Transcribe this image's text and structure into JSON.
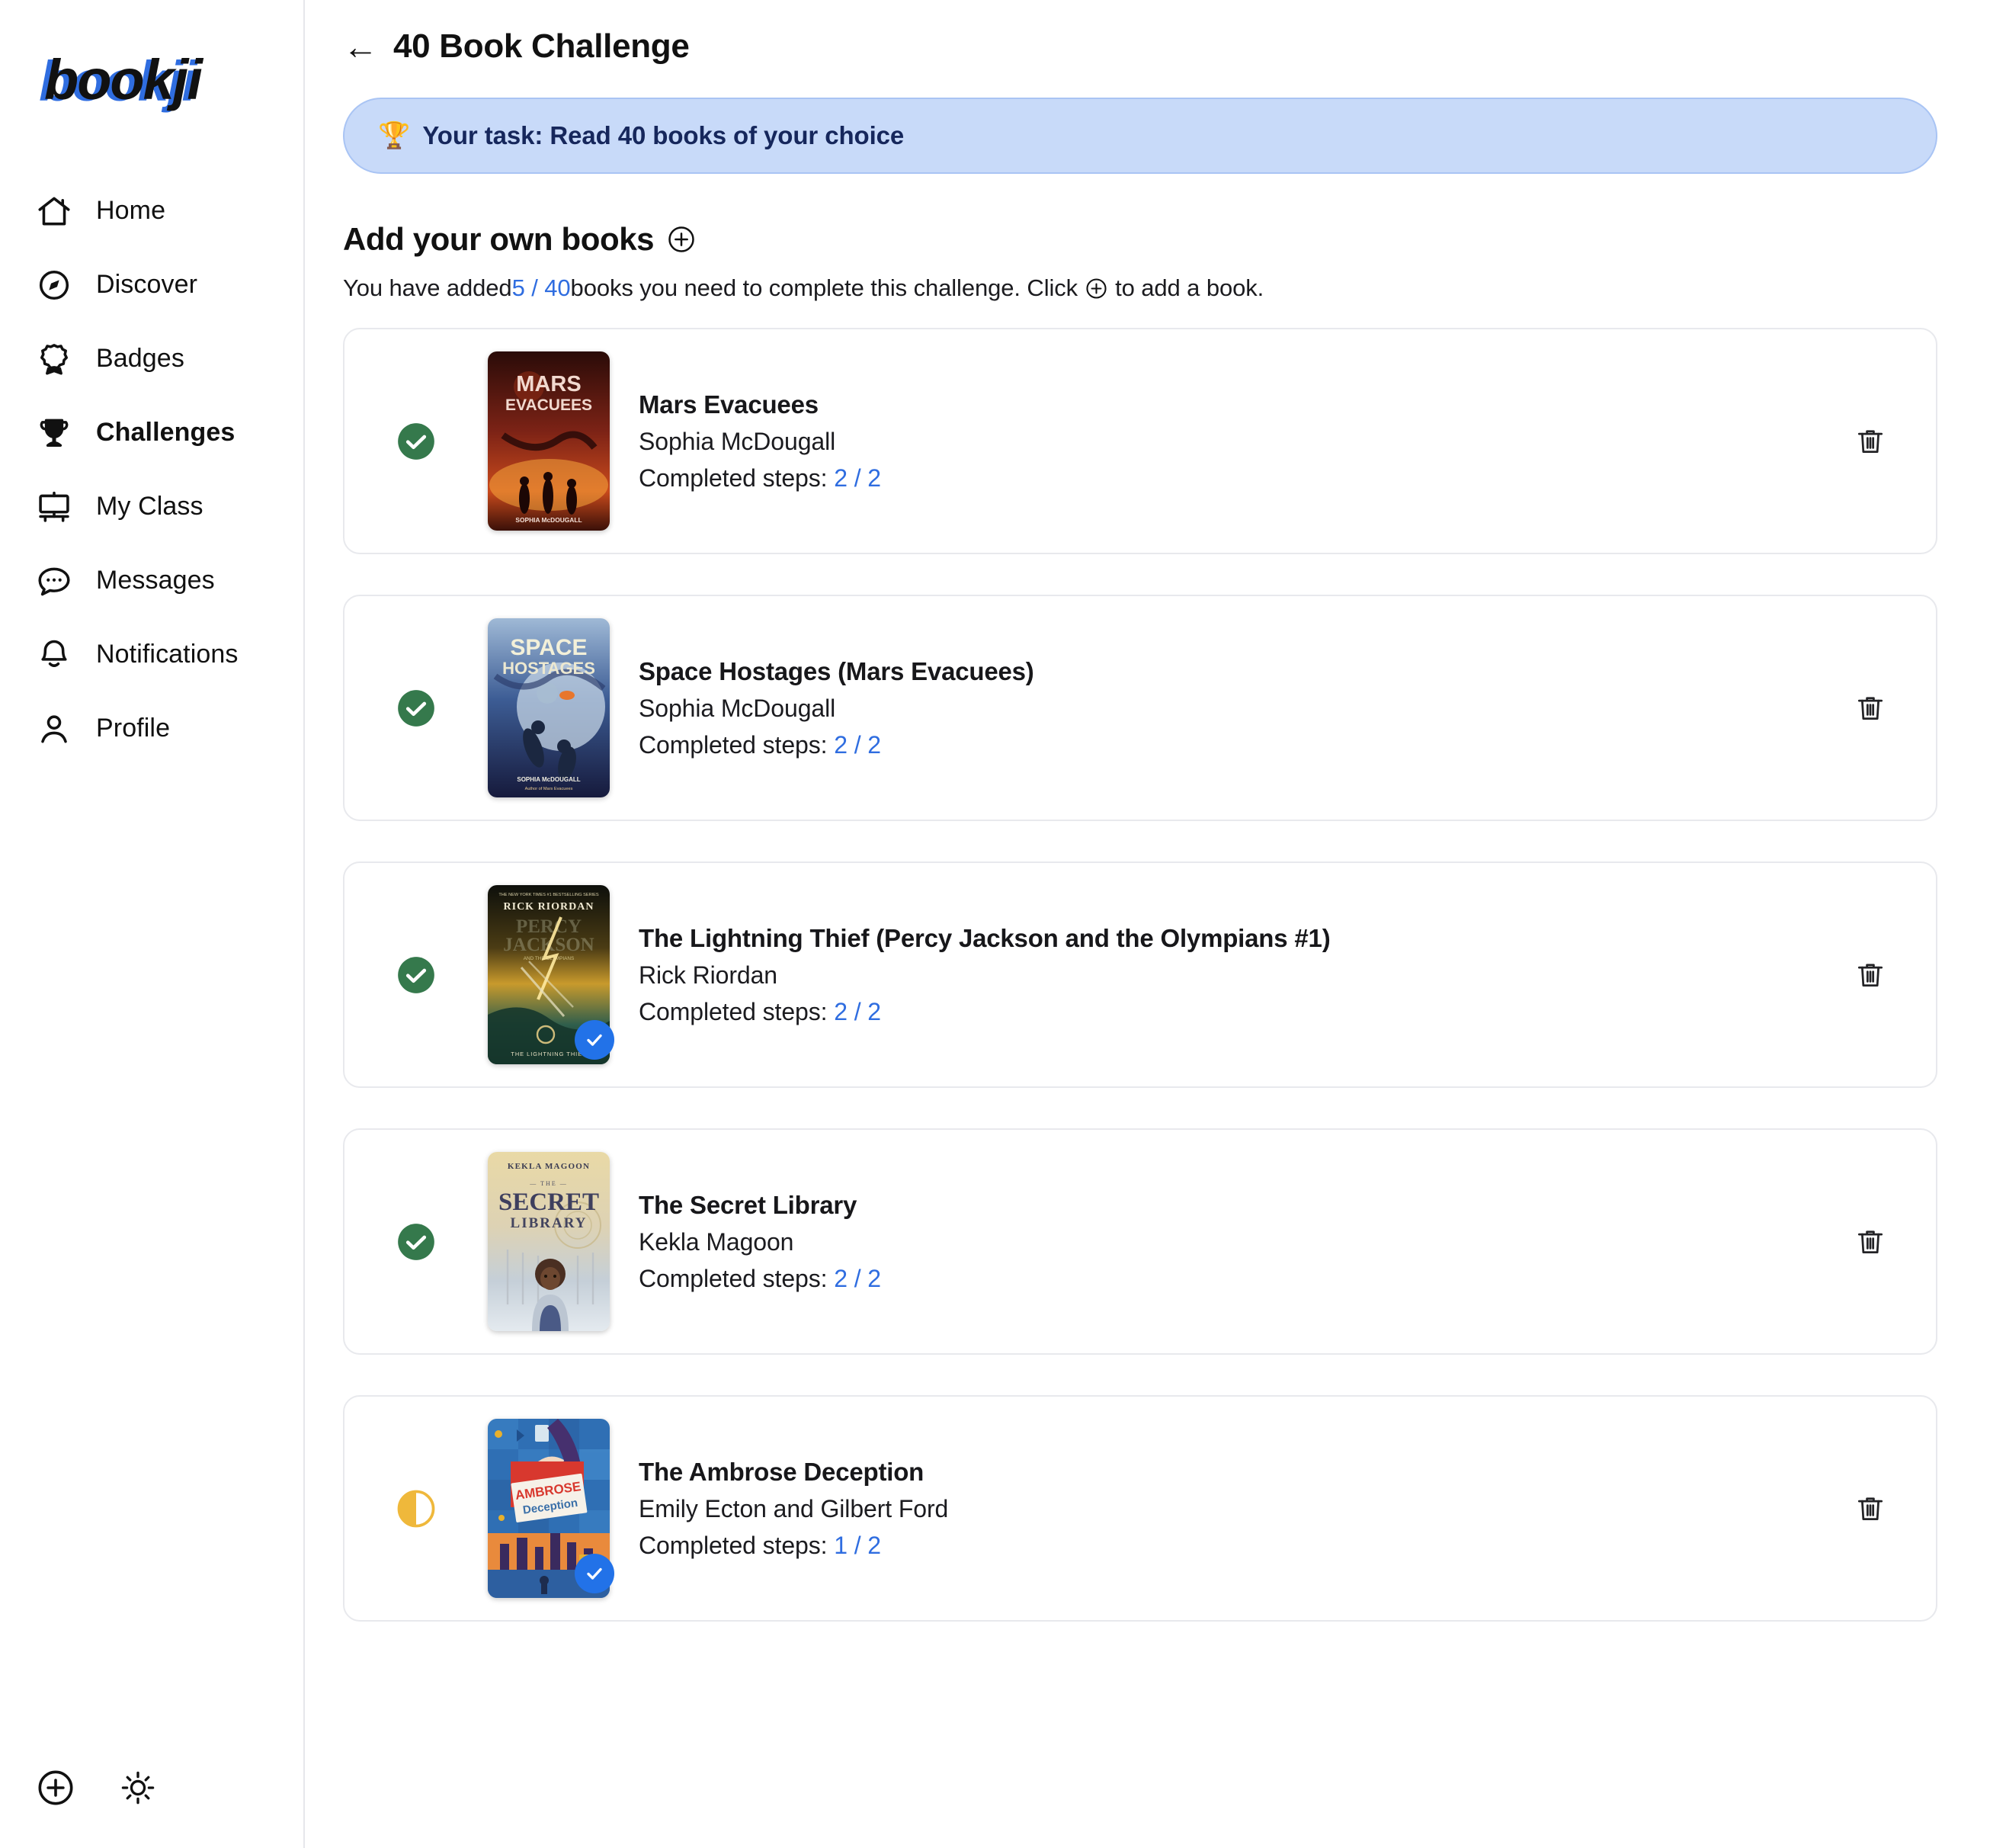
{
  "brand": {
    "name": "bookji"
  },
  "sidebar": {
    "items": [
      {
        "label": "Home",
        "icon": "home-icon",
        "active": false
      },
      {
        "label": "Discover",
        "icon": "compass-icon",
        "active": false
      },
      {
        "label": "Badges",
        "icon": "badge-icon",
        "active": false
      },
      {
        "label": "Challenges",
        "icon": "trophy-icon",
        "active": true
      },
      {
        "label": "My Class",
        "icon": "whiteboard-icon",
        "active": false
      },
      {
        "label": "Messages",
        "icon": "chat-bubble-icon",
        "active": false
      },
      {
        "label": "Notifications",
        "icon": "bell-icon",
        "active": false
      },
      {
        "label": "Profile",
        "icon": "person-icon",
        "active": false
      }
    ],
    "bottom": [
      {
        "icon": "plus-circle-icon"
      },
      {
        "icon": "sun-icon"
      }
    ]
  },
  "header": {
    "back_arrow": "←",
    "title": "40 Book Challenge"
  },
  "task_banner": {
    "emoji": "🏆",
    "text": "Your task: Read 40 books of your choice",
    "bg_color": "#c8daf9",
    "text_color": "#16275c"
  },
  "section": {
    "title": "Add your own books",
    "add_icon": "plus-circle-icon",
    "sub_prefix": "You have added ",
    "sub_count": "5 / 40",
    "sub_middle": " books you need to complete this challenge. Click ",
    "sub_suffix": " to add a book.",
    "accent_color": "#2f6de0"
  },
  "steps_label": "Completed steps: ",
  "delete_icon": "trash-icon",
  "status_colors": {
    "complete": "#35794c",
    "partial": "#efb83b",
    "badge": "#2272e8"
  },
  "books": [
    {
      "title": "Mars Evacuees",
      "author": "Sophia McDougall",
      "steps": "2 / 2",
      "status": "complete",
      "status_icon": "check-circle-icon",
      "cover_badge": false,
      "cover": "mars-evacuees-cover"
    },
    {
      "title": "Space Hostages (Mars Evacuees)",
      "author": "Sophia McDougall",
      "steps": "2 / 2",
      "status": "complete",
      "status_icon": "check-circle-icon",
      "cover_badge": false,
      "cover": "space-hostages-cover"
    },
    {
      "title": "The Lightning Thief (Percy Jackson and the Olympians #1)",
      "author": "Rick Riordan",
      "steps": "2 / 2",
      "status": "complete",
      "status_icon": "check-circle-icon",
      "cover_badge": true,
      "cover": "lightning-thief-cover"
    },
    {
      "title": "The Secret Library",
      "author": "Kekla Magoon",
      "steps": "2 / 2",
      "status": "complete",
      "status_icon": "check-circle-icon",
      "cover_badge": false,
      "cover": "secret-library-cover"
    },
    {
      "title": "The Ambrose Deception",
      "author": "Emily Ecton and Gilbert Ford",
      "steps": "1 / 2",
      "status": "partial",
      "status_icon": "half-circle-icon",
      "cover_badge": true,
      "cover": "ambrose-deception-cover"
    }
  ]
}
